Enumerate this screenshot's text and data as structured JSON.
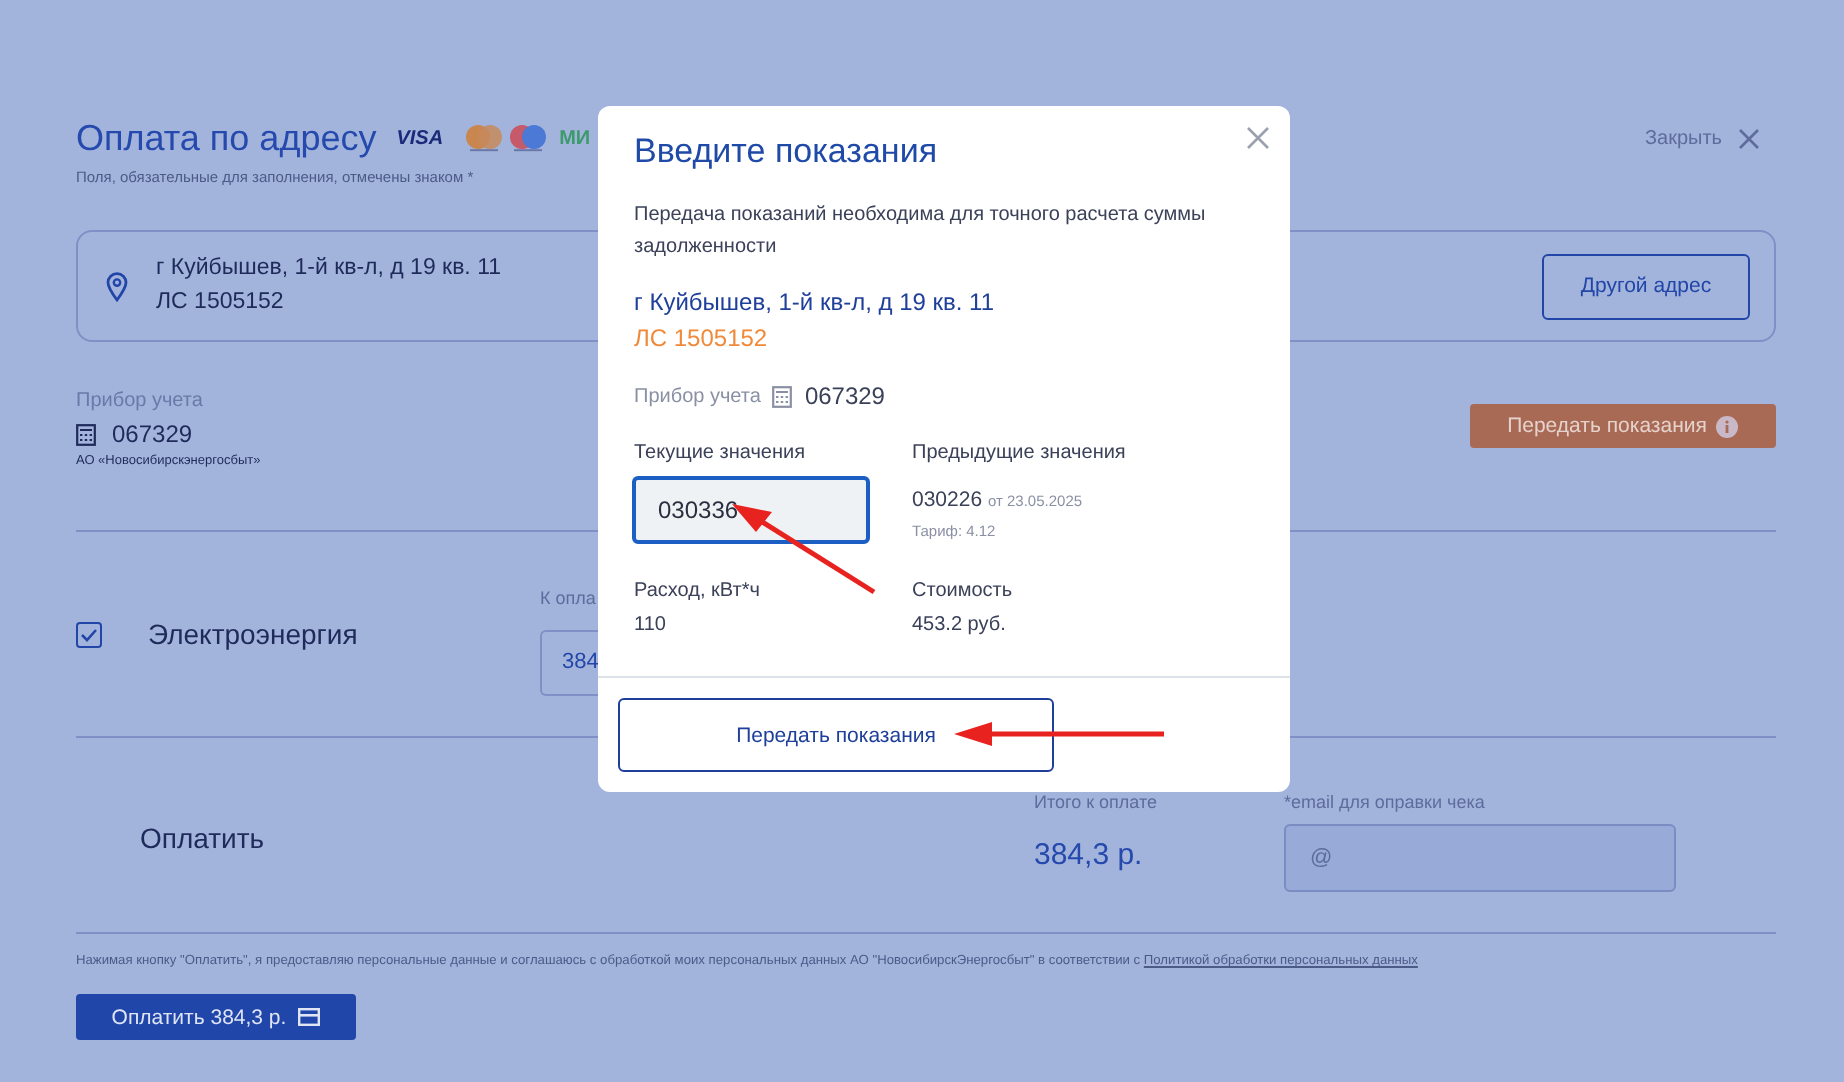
{
  "page": {
    "title": "Оплата по адресу",
    "payment_logos": [
      {
        "kind": "visa",
        "text": "VISA"
      },
      {
        "kind": "mastercard"
      },
      {
        "kind": "maestro"
      },
      {
        "kind": "mir",
        "text": "МИ"
      }
    ],
    "close": "Закрыть",
    "required_note": "Поля, обязательные для заполнения, отмечены знаком *",
    "address": {
      "line1": "г Куйбышев, 1-й кв-л, д 19 кв. 11",
      "line2": "ЛС 1505152"
    },
    "other_address_button": "Другой адрес",
    "meter": {
      "label": "Прибор учета",
      "number": "067329",
      "company": "АО «Новосибирскэнергосбыт»"
    },
    "submit_readings_button": "Передать показания",
    "services": [
      {
        "name": "Электроэнергия",
        "checked": true,
        "amount_label": "К опла",
        "amount": "384"
      }
    ],
    "pay": {
      "title": "Оплатить",
      "total_label": "Итого к оплате",
      "total": "384,3 р.",
      "email_label": "*email для оправки чека",
      "email_placeholder": "@"
    },
    "consent": {
      "text": "Нажимая кнопку \"Оплатить\", я предоставляю персональные данные и соглашаюсь с обработкой моих персональных данных АО \"НовосибирскЭнергосбыт\" в соответствии с ",
      "link": "Политикой обработки персональных данных"
    },
    "pay_button": "Оплатить 384,3 р."
  },
  "modal": {
    "title": "Введите показания",
    "description": "Передача показаний необходима для точного расчета суммы задолженности",
    "address": "г Куйбышев, 1-й кв-л, д 19 кв. 11",
    "account": "ЛС 1505152",
    "meter_label": "Прибор учета",
    "meter_number": "067329",
    "current_label": "Текущие значения",
    "current_value": "030336",
    "previous_label": "Предыдущие значения",
    "previous_value": "030226",
    "previous_date": "от 23.05.2025",
    "tariff": "Тариф: 4.12",
    "consumption_label": "Расход, кВт*ч",
    "consumption": "110",
    "cost_label": "Стоимость",
    "cost": "453.2 руб.",
    "submit_button": "Передать показания"
  }
}
